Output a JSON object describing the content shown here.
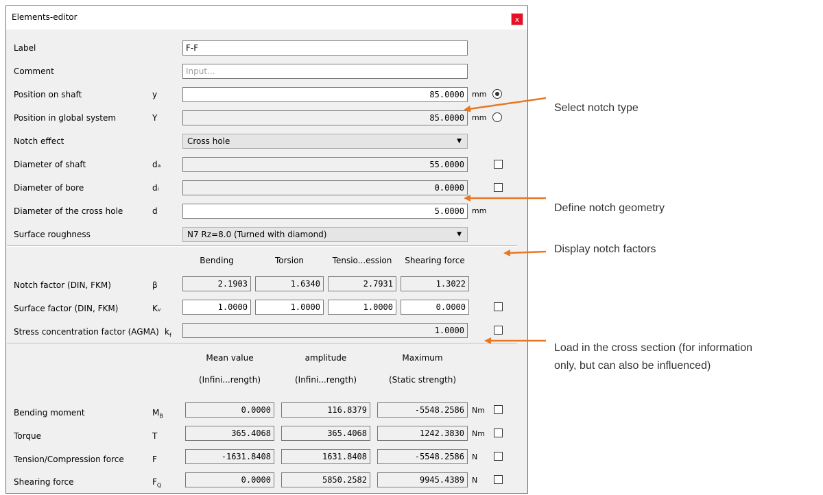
{
  "window": {
    "title": "Elements-editor",
    "close": "x"
  },
  "rows": {
    "label": {
      "label": "Label",
      "value": "F-F"
    },
    "comment": {
      "label": "Comment",
      "placeholder": "Input..."
    },
    "pos_shaft": {
      "label": "Position on shaft",
      "symbol": "y",
      "value": "85.0000",
      "unit": "mm",
      "selected": true
    },
    "pos_global": {
      "label": "Position in global system",
      "symbol": "Y",
      "value": "85.0000",
      "unit": "mm",
      "selected": false
    },
    "notch_effect": {
      "label": "Notch effect",
      "value": "Cross hole"
    },
    "dia_shaft": {
      "label": "Diameter of shaft",
      "symbol": "dₐ",
      "value": "55.0000"
    },
    "dia_bore": {
      "label": "Diameter of bore",
      "symbol": "dᵢ",
      "value": "0.0000"
    },
    "dia_cross": {
      "label": "Diameter of the cross hole",
      "symbol": "d",
      "value": "5.0000",
      "unit": "mm"
    },
    "roughness": {
      "label": "Surface roughness",
      "value": "N7  Rz=8.0 (Turned with diamond)"
    }
  },
  "factors": {
    "headers": [
      "Bending",
      "Torsion",
      "Tensio...ession",
      "Shearing force"
    ],
    "notch": {
      "label": "Notch factor (DIN, FKM)",
      "symbol": "β",
      "values": [
        "2.1903",
        "1.6340",
        "2.7931",
        "1.3022"
      ]
    },
    "surface": {
      "label": "Surface factor (DIN, FKM)",
      "symbol": "Kᵥ",
      "values": [
        "1.0000",
        "1.0000",
        "1.0000",
        "0.0000"
      ]
    },
    "stress": {
      "label": "Stress concentration factor (AGMA)",
      "symbol": "k_f",
      "value": "1.0000"
    }
  },
  "loads": {
    "headers": [
      "Mean value",
      "amplitude",
      "Maximum"
    ],
    "subheaders": [
      "(Infini...rength)",
      "(Infini...rength)",
      "(Static strength)"
    ],
    "rows": [
      {
        "label": "Bending moment",
        "symbol": "M_B",
        "values": [
          "0.0000",
          "116.8379",
          "-5548.2586"
        ],
        "unit": "Nm"
      },
      {
        "label": "Torque",
        "symbol": "T",
        "values": [
          "365.4068",
          "365.4068",
          "1242.3830"
        ],
        "unit": "Nm"
      },
      {
        "label": "Tension/Compression force",
        "symbol": "F",
        "values": [
          "-1631.8408",
          "1631.8408",
          "-5548.2586"
        ],
        "unit": "N"
      },
      {
        "label": "Shearing force",
        "symbol": "F_Q",
        "values": [
          "0.0000",
          "5850.2582",
          "9945.4389"
        ],
        "unit": "N"
      }
    ]
  },
  "annotations": {
    "select_notch": "Select notch type",
    "define_geometry": "Define notch geometry",
    "display_factors": "Display notch factors",
    "load_line1": "Load in the cross section (for information",
    "load_line2": "only, but can also be influenced)"
  },
  "colors": {
    "arrow": "#e87722",
    "close_button": "#e81123",
    "window_bg": "#f0f0f0"
  }
}
